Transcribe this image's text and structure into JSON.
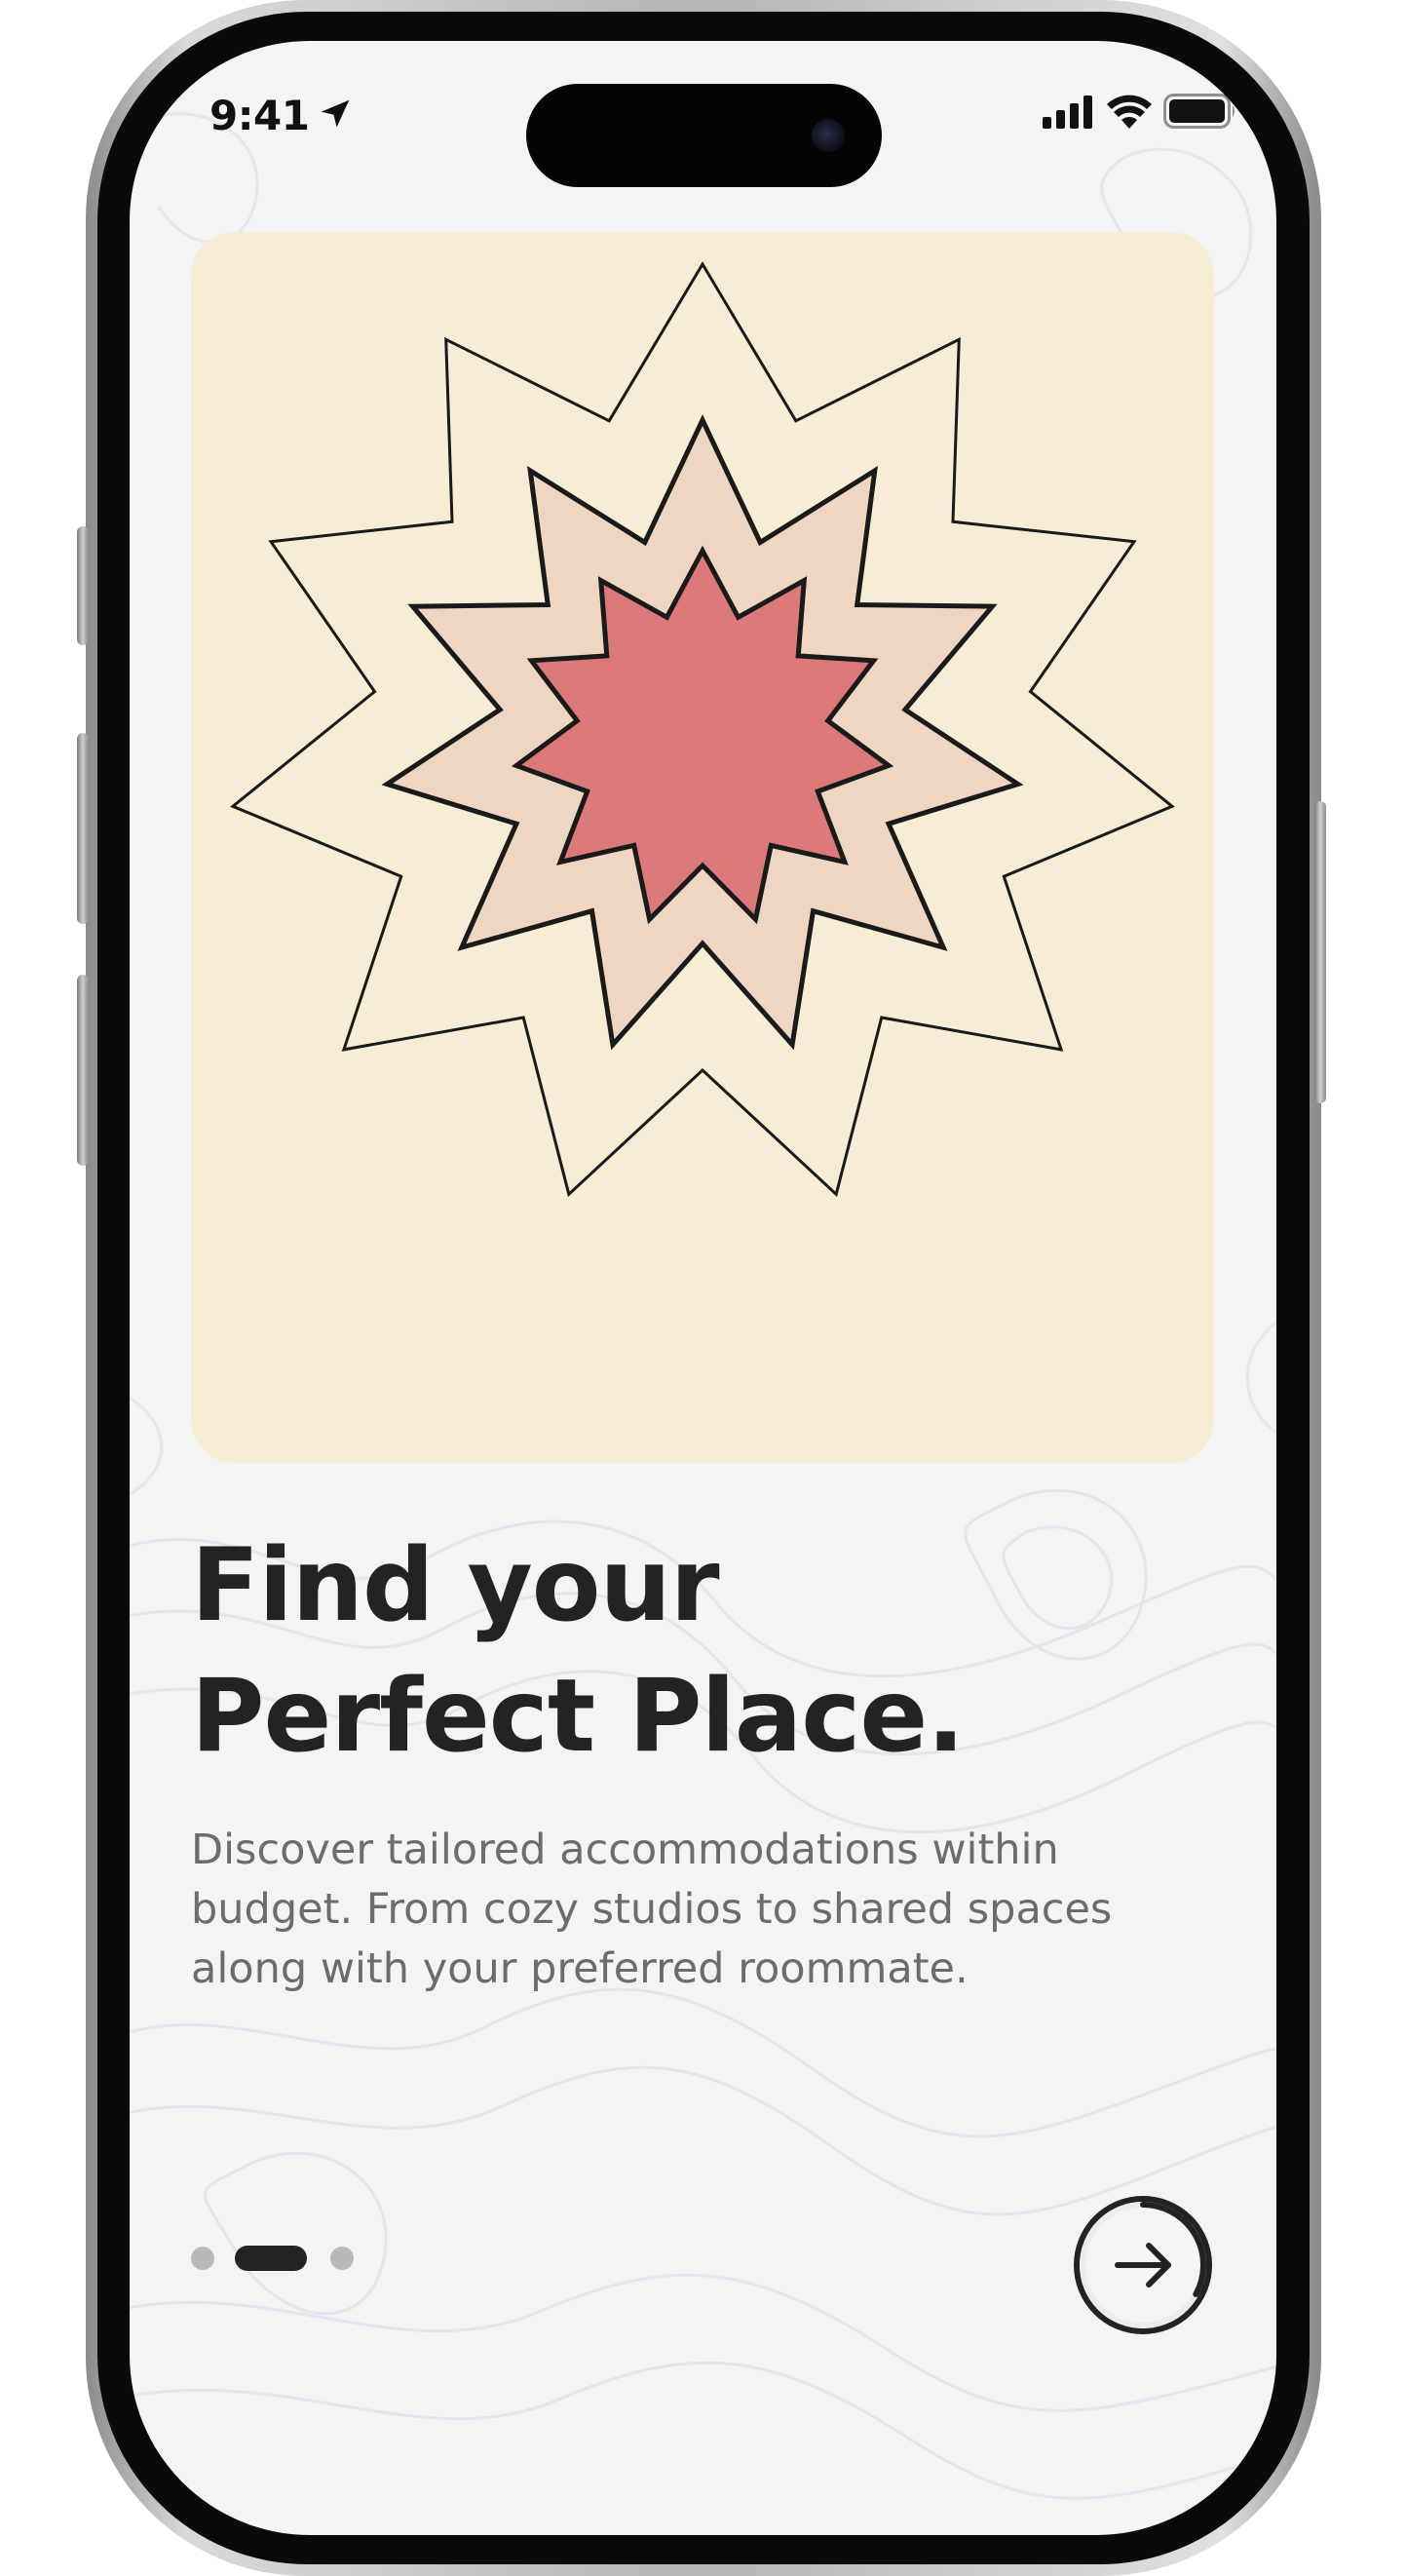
{
  "status_bar": {
    "time": "9:41",
    "location_icon": "location-arrow-icon",
    "signal_icon": "cellular-signal-icon",
    "wifi_icon": "wifi-icon",
    "battery_icon": "battery-icon"
  },
  "hero": {
    "illustration": "concentric-star-burst",
    "colors": {
      "card_background": "#f7ecd6",
      "outer_star": "#f7ecd6",
      "middle_star": "#efd6c2",
      "inner_star": "#dc7a7b",
      "stroke": "#1a1a1a"
    }
  },
  "content": {
    "headline_line1": "Find your",
    "headline_line2": "Perfect Place.",
    "description": "Discover tailored accommodations within budget. From cozy studios to shared spaces along with your preferred roommate."
  },
  "pagination": {
    "total_pages": 3,
    "current_page": 2
  },
  "next_button": {
    "icon": "arrow-right-icon",
    "progress": 0.33
  }
}
